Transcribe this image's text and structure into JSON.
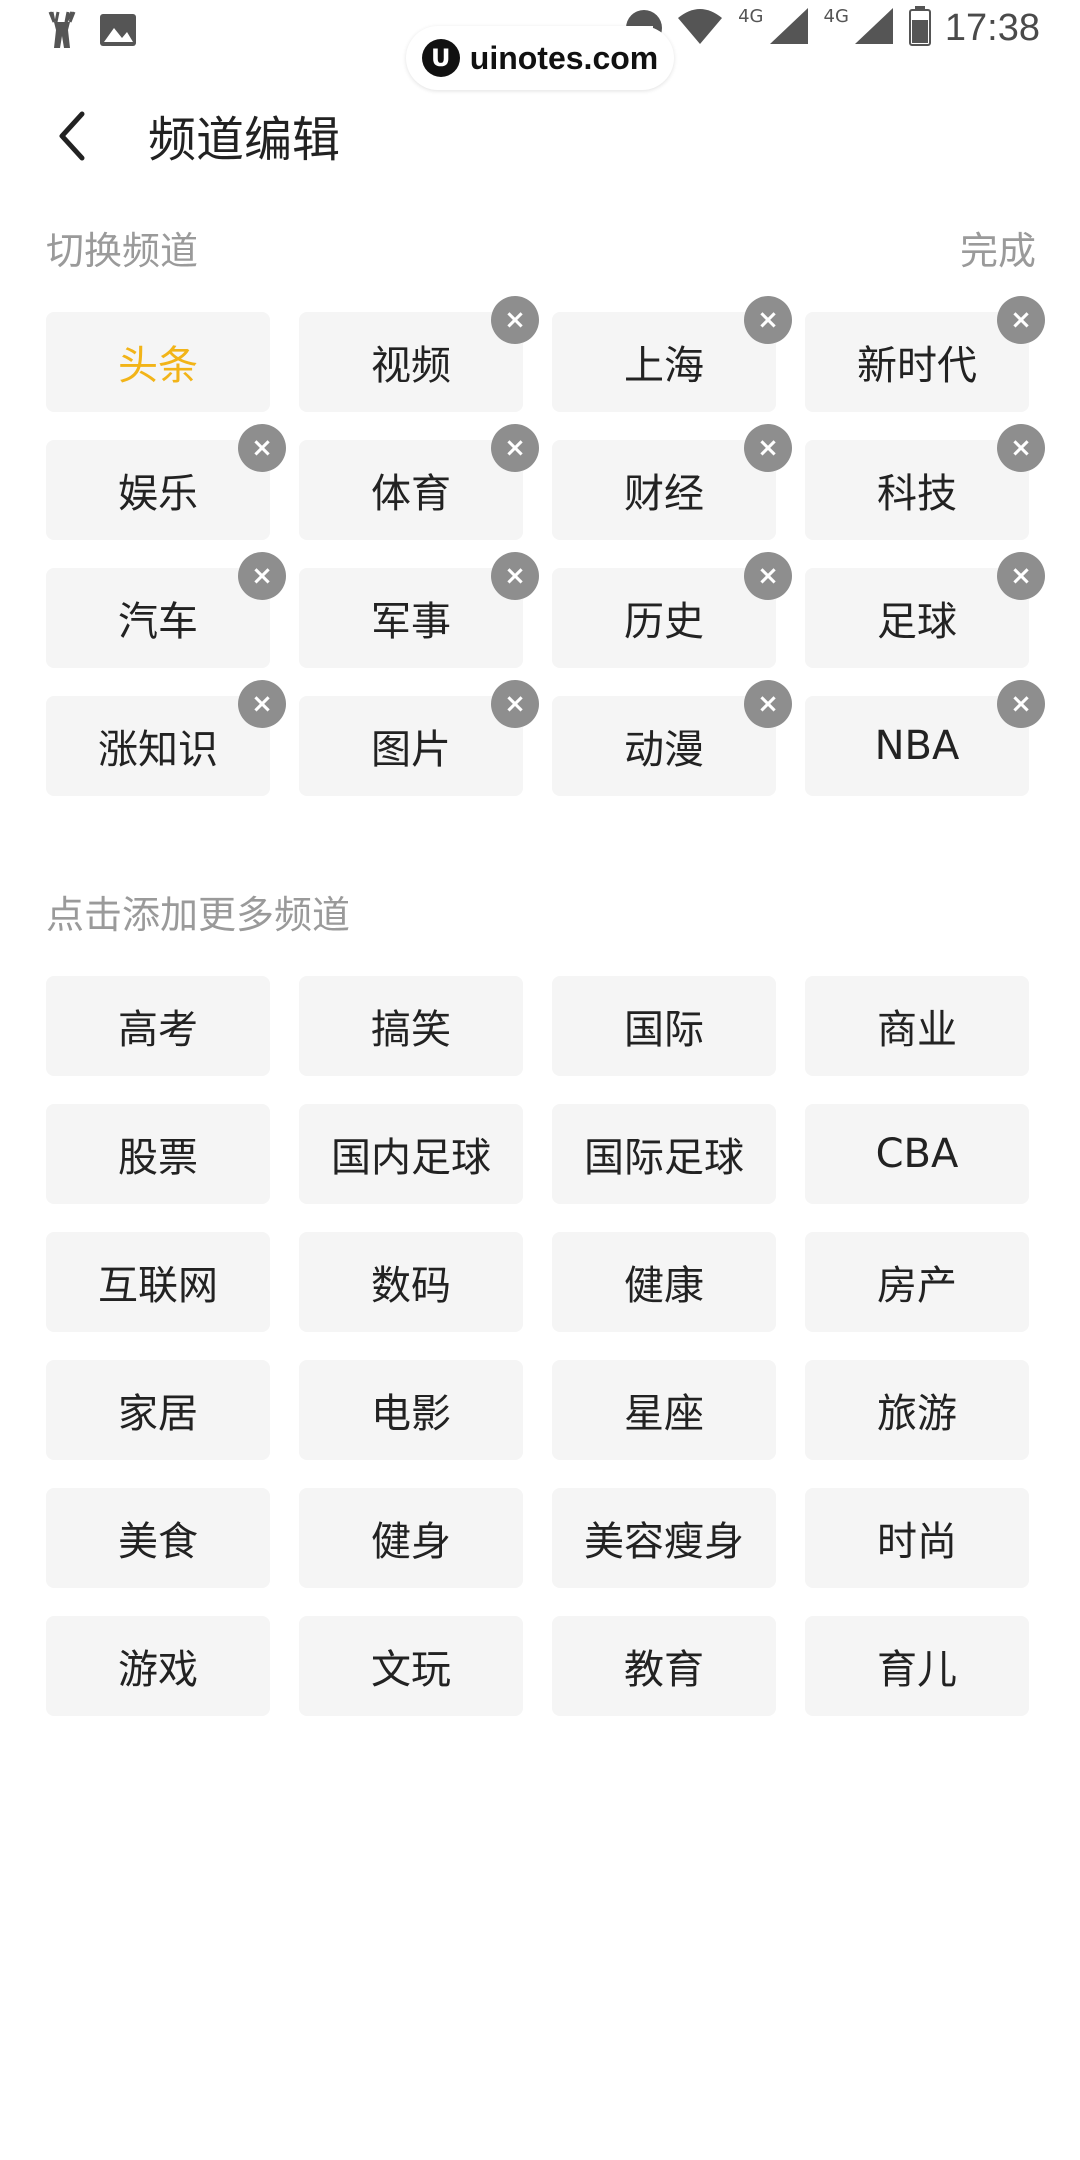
{
  "status_bar": {
    "time": "17:38",
    "net1": "4G",
    "net2": "4G",
    "watermark": "uinotes.com",
    "icons": [
      "deer-icon",
      "image-icon",
      "do-not-disturb-icon",
      "wifi-icon",
      "signal-icon",
      "battery-icon"
    ]
  },
  "header": {
    "title": "频道编辑"
  },
  "my_channels": {
    "label": "切换频道",
    "done_label": "完成",
    "items": [
      {
        "label": "头条",
        "active": true,
        "removable": false
      },
      {
        "label": "视频",
        "removable": true
      },
      {
        "label": "上海",
        "removable": true
      },
      {
        "label": "新时代",
        "removable": true
      },
      {
        "label": "娱乐",
        "removable": true
      },
      {
        "label": "体育",
        "removable": true
      },
      {
        "label": "财经",
        "removable": true
      },
      {
        "label": "科技",
        "removable": true
      },
      {
        "label": "汽车",
        "removable": true
      },
      {
        "label": "军事",
        "removable": true
      },
      {
        "label": "历史",
        "removable": true
      },
      {
        "label": "足球",
        "removable": true
      },
      {
        "label": "涨知识",
        "removable": true
      },
      {
        "label": "图片",
        "removable": true
      },
      {
        "label": "动漫",
        "removable": true
      },
      {
        "label": "NBA",
        "removable": true
      }
    ]
  },
  "more_channels": {
    "label": "点击添加更多频道",
    "items": [
      {
        "label": "高考"
      },
      {
        "label": "搞笑"
      },
      {
        "label": "国际"
      },
      {
        "label": "商业"
      },
      {
        "label": "股票"
      },
      {
        "label": "国内足球"
      },
      {
        "label": "国际足球"
      },
      {
        "label": "CBA"
      },
      {
        "label": "互联网"
      },
      {
        "label": "数码"
      },
      {
        "label": "健康"
      },
      {
        "label": "房产"
      },
      {
        "label": "家居"
      },
      {
        "label": "电影"
      },
      {
        "label": "星座"
      },
      {
        "label": "旅游"
      },
      {
        "label": "美食"
      },
      {
        "label": "健身"
      },
      {
        "label": "美容瘦身"
      },
      {
        "label": "时尚"
      },
      {
        "label": "游戏"
      },
      {
        "label": "文玩"
      },
      {
        "label": "教育"
      },
      {
        "label": "育儿"
      }
    ]
  },
  "colors": {
    "active": "#f2b418",
    "chip_bg": "#f5f5f5",
    "close_bg": "#8e8e8e",
    "muted_text": "#9a9a9a"
  }
}
